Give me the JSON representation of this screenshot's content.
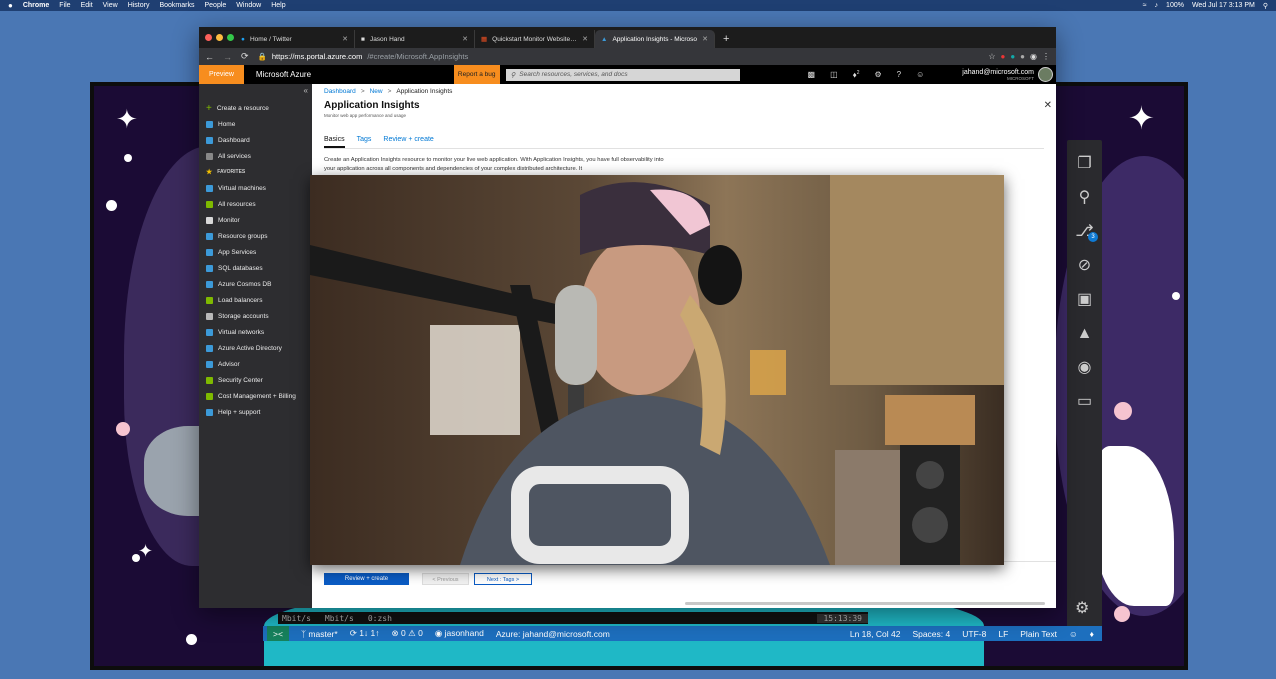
{
  "menubar": {
    "apple": "",
    "app": "Chrome",
    "items": [
      "File",
      "Edit",
      "View",
      "History",
      "Bookmarks",
      "People",
      "Window",
      "Help"
    ],
    "battery": "100%",
    "datetime": "Wed Jul 17  3:13 PM"
  },
  "browser": {
    "tabs": [
      {
        "title": "Home / Twitter",
        "icon": "twitter-icon"
      },
      {
        "title": "Jason Hand",
        "icon": "page-icon"
      },
      {
        "title": "Quickstart Monitor Websites w",
        "icon": "microsoft-icon"
      },
      {
        "title": "Application Insights - Microso",
        "icon": "azure-icon"
      }
    ],
    "url_host": "https://ms.portal.azure.com",
    "url_path": "/#create/Microsoft.AppInsights"
  },
  "azure": {
    "preview": "Preview",
    "brand": "Microsoft Azure",
    "report_bug": "Report a bug",
    "search_placeholder": "Search resources, services, and docs",
    "notification_count": "2",
    "user_email": "jahand@microsoft.com",
    "user_org": "MICROSOFT",
    "sidebar": {
      "create": "Create a resource",
      "home": "Home",
      "dashboard": "Dashboard",
      "all_services": "All services",
      "favorites": "FAVORITES",
      "items": [
        {
          "label": "Virtual machines",
          "color": "#3c9ad8"
        },
        {
          "label": "All resources",
          "color": "#7fba00"
        },
        {
          "label": "Monitor",
          "color": "#d8d8d8"
        },
        {
          "label": "Resource groups",
          "color": "#3c9ad8"
        },
        {
          "label": "App Services",
          "color": "#3c9ad8"
        },
        {
          "label": "SQL databases",
          "color": "#3c9ad8"
        },
        {
          "label": "Azure Cosmos DB",
          "color": "#3c9ad8"
        },
        {
          "label": "Load balancers",
          "color": "#7fba00"
        },
        {
          "label": "Storage accounts",
          "color": "#b8b8b8"
        },
        {
          "label": "Virtual networks",
          "color": "#3c9ad8"
        },
        {
          "label": "Azure Active Directory",
          "color": "#3c9ad8"
        },
        {
          "label": "Advisor",
          "color": "#3c9ad8"
        },
        {
          "label": "Security Center",
          "color": "#7fba00"
        },
        {
          "label": "Cost Management + Billing",
          "color": "#7fba00"
        },
        {
          "label": "Help + support",
          "color": "#3c9ad8"
        }
      ]
    },
    "blade": {
      "breadcrumb": [
        "Dashboard",
        "New",
        "Application Insights"
      ],
      "title": "Application Insights",
      "subtitle": "Monitor web app performance and usage",
      "tabs": [
        "Basics",
        "Tags",
        "Review + create"
      ],
      "description": "Create an Application Insights resource to monitor your live web application. With Application Insights, you have full observability into your application across all components and dependencies of your complex distributed architecture. It",
      "review_create": "Review + create",
      "previous": "< Previous",
      "next": "Next : Tags >"
    }
  },
  "vscode": {
    "scm_badge": "3",
    "terminal": {
      "col1": "Mbit/s",
      "col2": "Mbit/s",
      "shell": "0:zsh",
      "time": "15:13:39"
    },
    "status": {
      "branch": "master*",
      "sync": "1↓ 1↑",
      "errors": "0",
      "warnings": "0",
      "github": "jasonhand",
      "azure": "Azure: jahand@microsoft.com",
      "position": "Ln 18, Col 42",
      "spaces": "Spaces: 4",
      "encoding": "UTF-8",
      "eol": "LF",
      "language": "Plain Text"
    }
  },
  "colors": {
    "azure_blue": "#0078d4",
    "preview_orange": "#f78d1e",
    "status_blue": "#1d6fbe"
  }
}
